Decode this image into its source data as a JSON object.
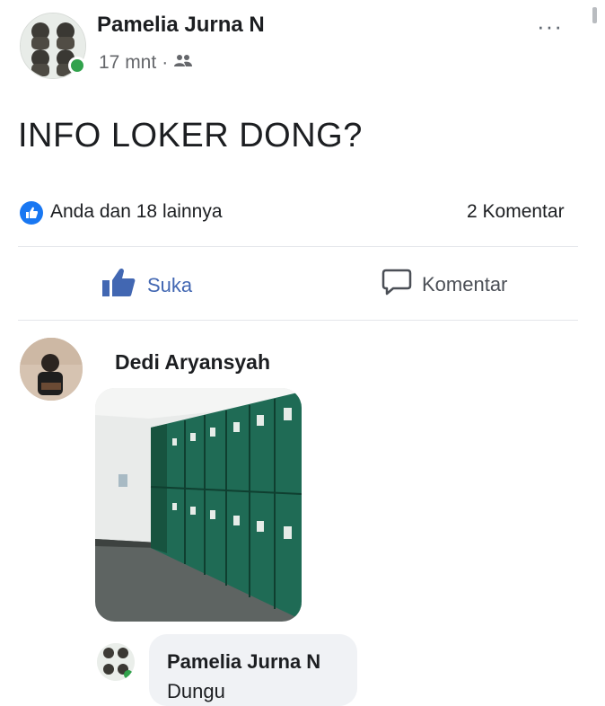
{
  "post": {
    "author_name": "Pamelia Jurna N",
    "time": "17 mnt",
    "separator": "·",
    "audience_icon": "friends-icon",
    "more_label": "···",
    "text": "INFO LOKER DONG?"
  },
  "reactions": {
    "icon": "like-badge-icon",
    "summary": "Anda dan 18 lainnya",
    "comment_count": "2 Komentar"
  },
  "actions": {
    "like_label": "Suka",
    "comment_label": "Komentar"
  },
  "comments": [
    {
      "author_name": "Dedi Aryansyah",
      "attachment": "lockers-photo"
    }
  ],
  "replies": [
    {
      "author_name": "Pamelia Jurna N",
      "text": "Dungu"
    }
  ],
  "colors": {
    "accent": "#1877f2",
    "like_text": "#4267b2",
    "online": "#31a24c",
    "meta_text": "#65676b",
    "locker_green": "#1f6b55"
  }
}
